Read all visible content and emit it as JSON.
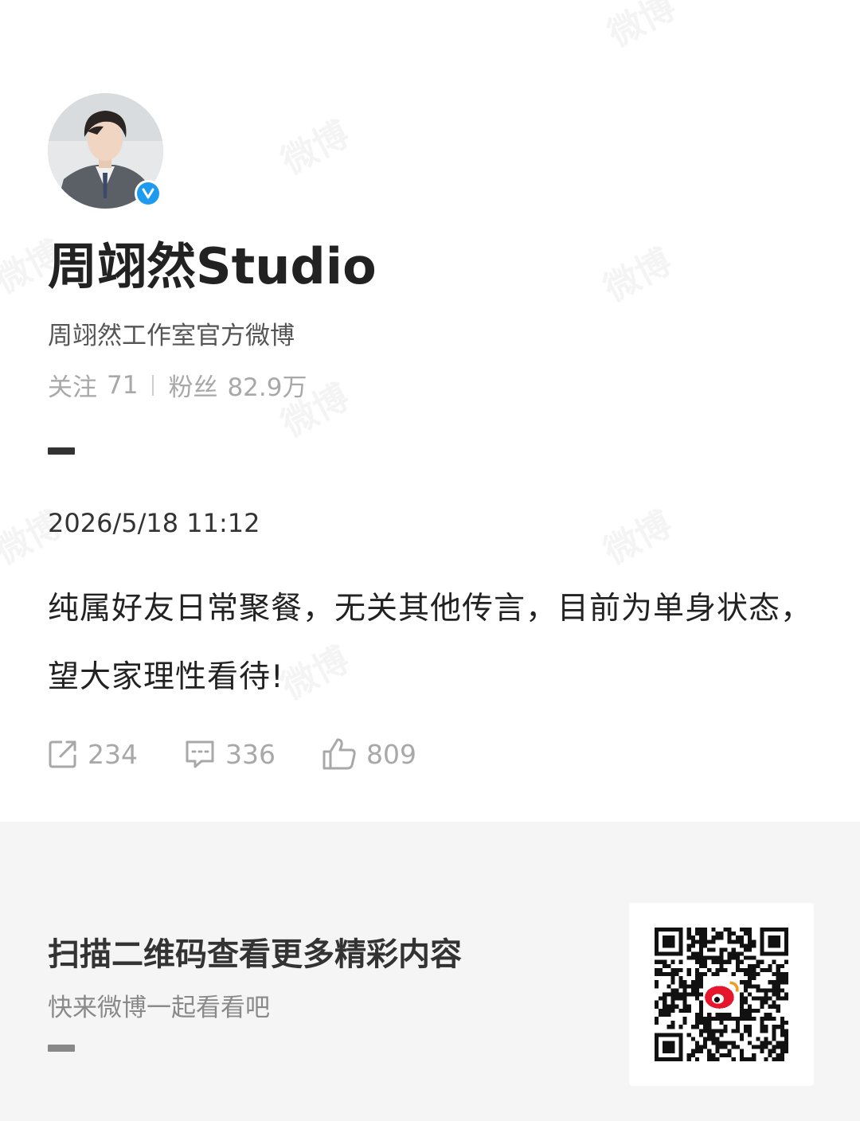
{
  "watermark": "微博",
  "profile": {
    "name": "周翊然Studio",
    "bio": "周翊然工作室官方微博",
    "following_label": "关注",
    "following_count": "71",
    "followers_label": "粉丝",
    "followers_count": "82.9万",
    "verified": true
  },
  "post": {
    "time": "2026/5/18 11:12",
    "content": "纯属好友日常聚餐，无关其他传言，目前为单身状态，望大家理性看待!",
    "reposts": "234",
    "comments": "336",
    "likes": "809"
  },
  "footer": {
    "title": "扫描二维码查看更多精彩内容",
    "subtitle": "快来微博一起看看吧"
  },
  "colors": {
    "verified": "#1d9bf0",
    "weibo_red": "#e6162d",
    "muted": "#a8a8a8"
  }
}
